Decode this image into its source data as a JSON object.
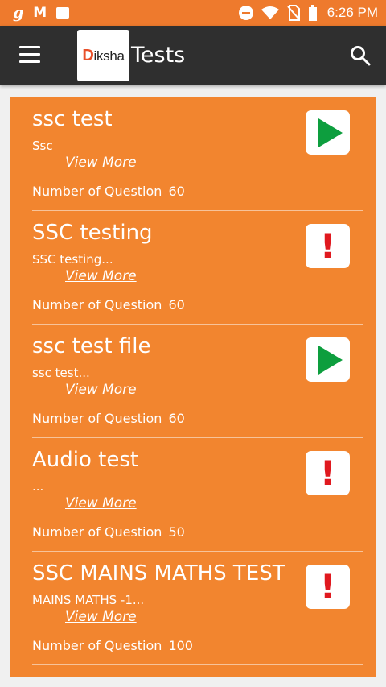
{
  "status_bar": {
    "time": "6:26 PM",
    "left_icons": [
      "g-icon",
      "m-notification-icon",
      "image-icon"
    ],
    "right_icons": [
      "dnd-icon",
      "wifi-icon",
      "no-sim-icon",
      "battery-icon"
    ]
  },
  "app_bar": {
    "logo_text_accent": "D",
    "logo_text_rest": "iksha",
    "title": "Tests",
    "menu_icon": "hamburger-icon",
    "search_icon": "search-icon"
  },
  "colors": {
    "accent": "#f2852f",
    "status_bar": "#ee7a2d",
    "app_bar": "#2f2f2f",
    "play_green": "#0d9e3e",
    "alert_red": "#e0191f"
  },
  "tests": [
    {
      "title": "ssc test",
      "description": "Ssc",
      "view_more": "View More",
      "count_label": "Number of Question",
      "count": "60",
      "status": "play"
    },
    {
      "title": "SSC testing",
      "description": "SSC testing...",
      "view_more": "View More",
      "count_label": "Number of Question",
      "count": "60",
      "status": "alert"
    },
    {
      "title": "ssc test file",
      "description": "ssc test...",
      "view_more": "View More",
      "count_label": "Number of Question",
      "count": "60",
      "status": "play"
    },
    {
      "title": "Audio test",
      "description": "...",
      "view_more": "View More",
      "count_label": "Number of Question",
      "count": "50",
      "status": "alert"
    },
    {
      "title": "SSC MAINS MATHS TEST",
      "description": "MAINS MATHS -1...",
      "view_more": "View More",
      "count_label": "Number of Question",
      "count": "100",
      "status": "alert"
    }
  ]
}
